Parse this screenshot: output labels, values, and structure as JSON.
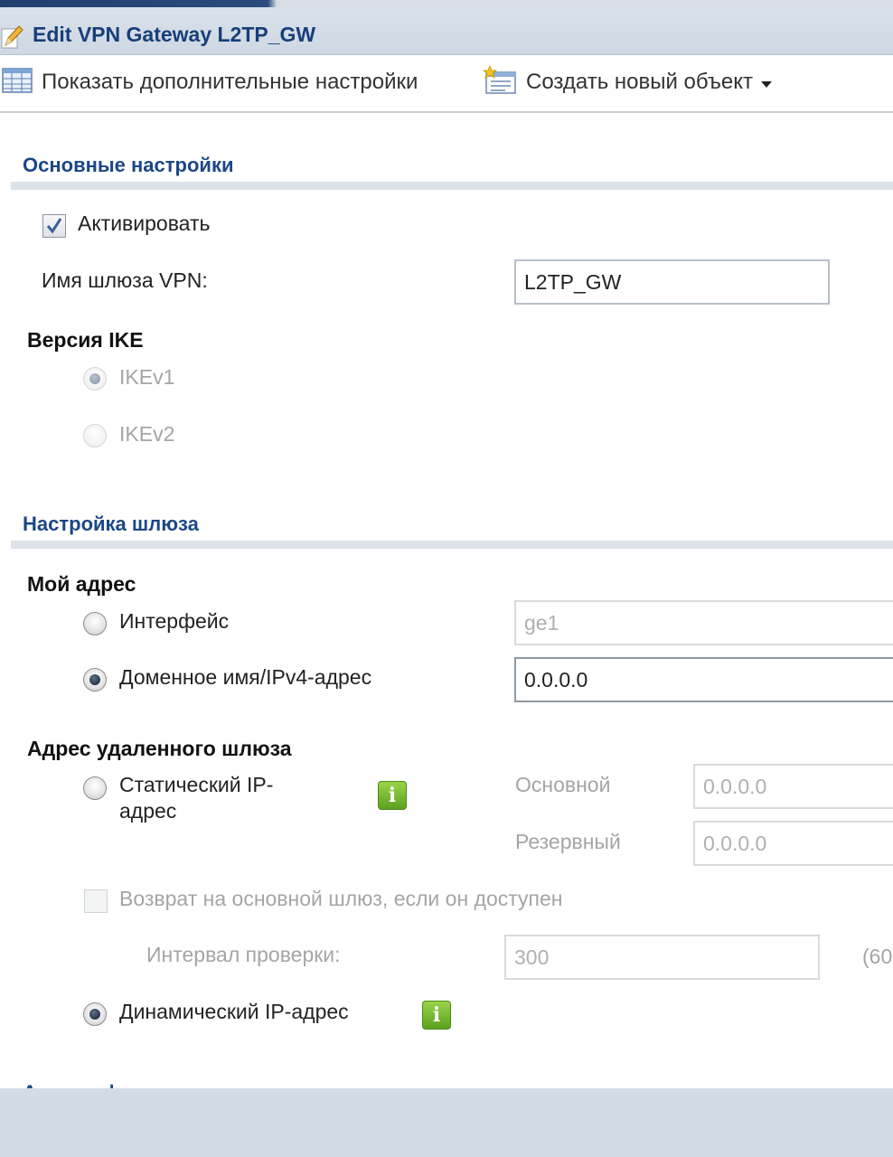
{
  "dialog": {
    "title": "Edit VPN Gateway L2TP_GW"
  },
  "toolbar": {
    "show_advanced_label": "Показать дополнительные настройки",
    "create_object_label": "Создать новый объект"
  },
  "general": {
    "section_title": "Основные настройки",
    "activate_label": "Активировать",
    "activate_checked": true,
    "gateway_name_label": "Имя шлюза VPN:",
    "gateway_name_value": "L2TP_GW",
    "ike_version_label": "Версия IKE",
    "ike_options": [
      "IKEv1",
      "IKEv2"
    ],
    "ike_selected": "IKEv1"
  },
  "gateway": {
    "section_title": "Настройка шлюза",
    "my_address_label": "Мой адрес",
    "interface_label": "Интерфейс",
    "interface_value": "ge1",
    "domain_label": "Доменное имя/IPv4-адрес",
    "domain_value": "0.0.0.0",
    "my_address_selected": "domain",
    "remote_label": "Адрес удаленного шлюза",
    "static_ip_label_line1": "Статический IP-",
    "static_ip_label_line2": "адрес",
    "primary_label": "Основной",
    "primary_value": "0.0.0.0",
    "backup_label": "Резервный",
    "backup_value": "0.0.0.0",
    "fallback_label": "Возврат на основной шлюз, если он доступен",
    "check_interval_label": "Интервал проверки:",
    "check_interval_value": "300",
    "check_interval_hint": "(60",
    "dynamic_ip_label": "Динамический IP-адрес",
    "remote_selected": "dynamic",
    "info_glyph": "i"
  },
  "next_section_partial": "Аутентификация",
  "colors": {
    "section_title": "#1c4787",
    "title_bar": "#d9e1ea",
    "info_badge": "#6fb52b"
  }
}
